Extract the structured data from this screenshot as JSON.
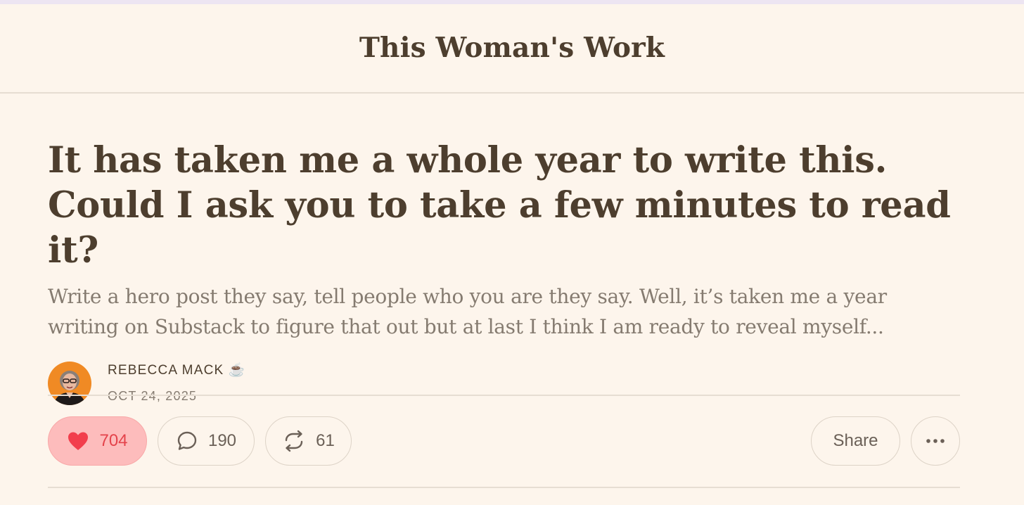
{
  "publication": {
    "name": "This Woman's Work"
  },
  "post": {
    "title": "It has taken me a whole year to write this. Could I ask you to take a few minutes to read it?",
    "subtitle": "Write a hero post they say, tell people who you are they say. Well, it’s taken me a year writing on Substack to figure that out but at last I think I am ready to reveal myself...",
    "author": "REBECCA MACK ☕",
    "date": "OCT 24, 2025"
  },
  "actions": {
    "likes": "704",
    "comments": "190",
    "restacks": "61",
    "share_label": "Share",
    "more_label": "···"
  },
  "icons": {
    "like": "heart-icon",
    "comment": "comment-bubble-icon",
    "restack": "restack-icon",
    "more": "ellipsis-icon"
  },
  "colors": {
    "background": "#fdf5ec",
    "text_primary": "#4d3e2e",
    "text_secondary": "#857b70",
    "like_bg": "#fdbcbc",
    "like_accent": "#e4434b",
    "divider": "#e6ddd2"
  }
}
